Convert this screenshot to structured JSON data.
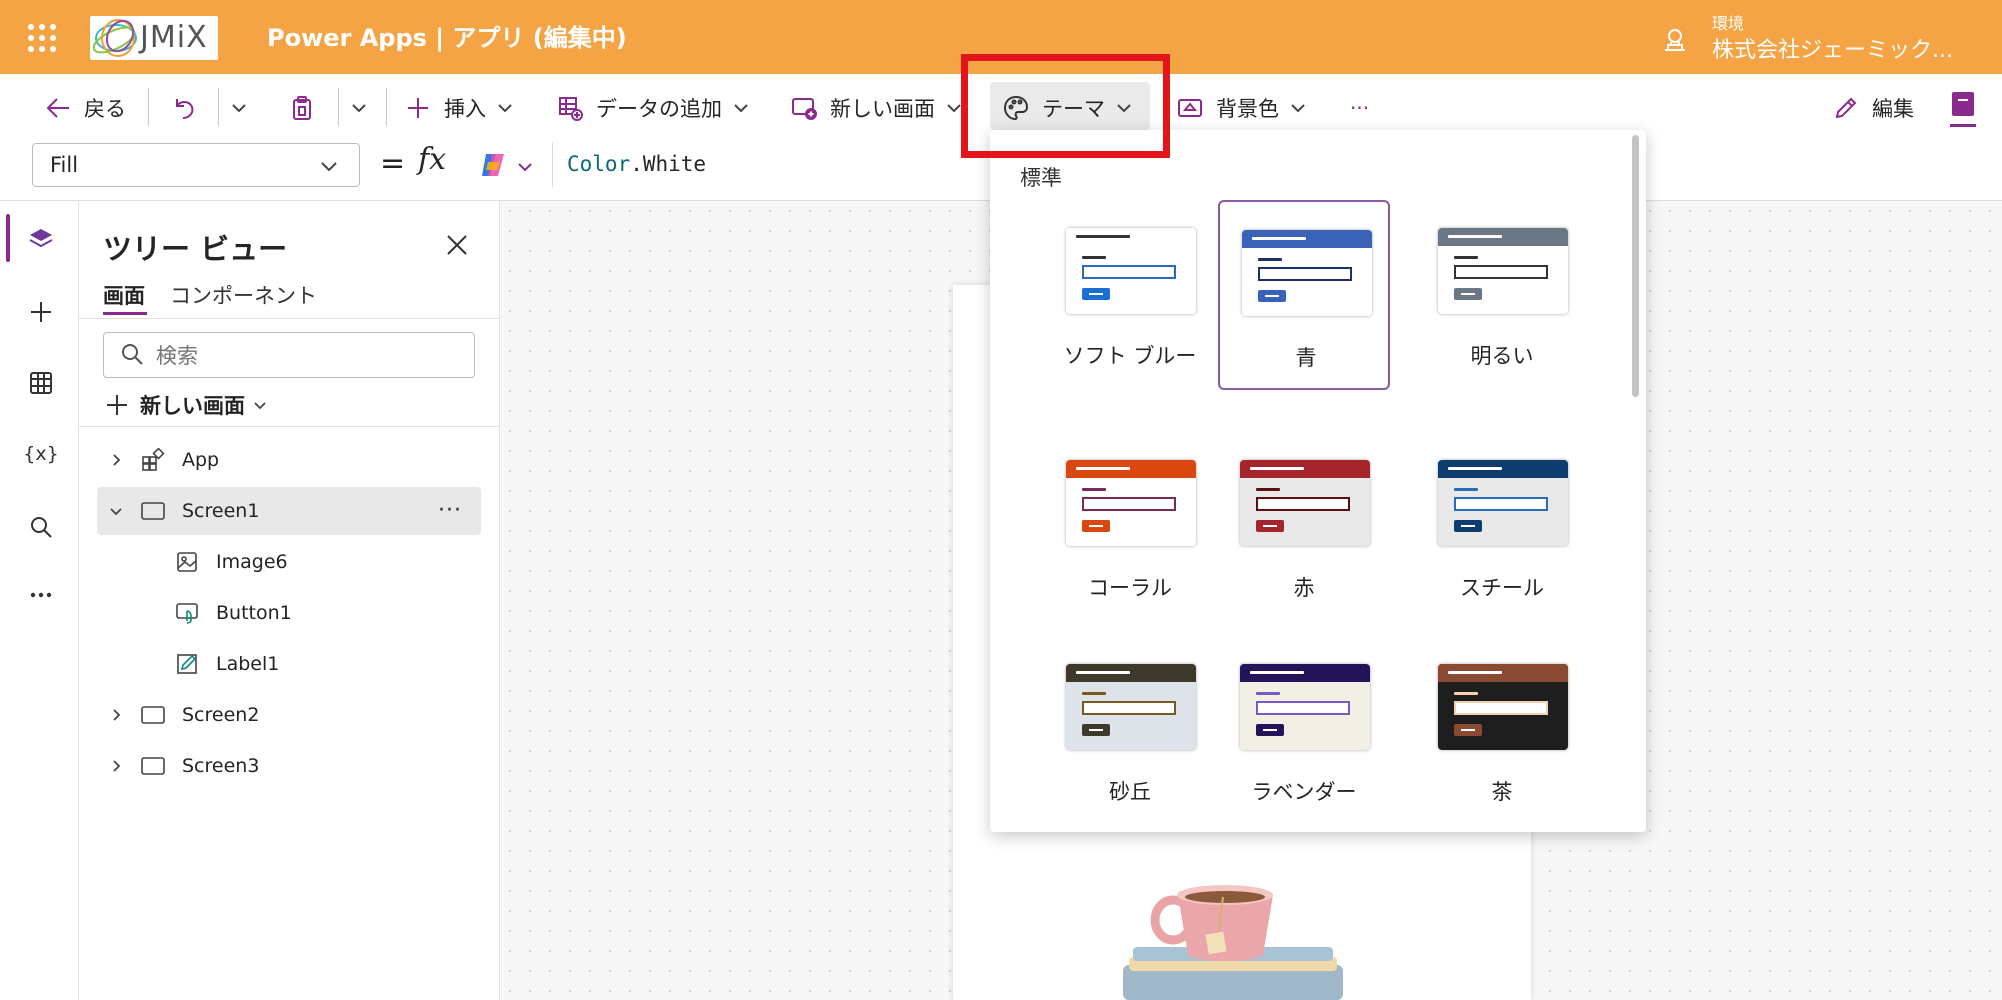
{
  "topbar": {
    "logo_text": "JMiX",
    "app_title": "Power Apps  |  アプリ (編集中)",
    "env_label": "環境",
    "env_name": "株式会社ジェーミック..."
  },
  "commands": {
    "back": "戻る",
    "insert": "挿入",
    "add_data": "データの追加",
    "new_screen": "新しい画面",
    "theme": "テーマ",
    "background": "背景色",
    "more": "···",
    "edit": "編集"
  },
  "formula_bar": {
    "property": "Fill",
    "eq": "=",
    "fx": "fx",
    "formula_obj": "Color",
    "formula_prop": ".White"
  },
  "tree": {
    "title": "ツリー ビュー",
    "tabs": [
      "画面",
      "コンポーネント"
    ],
    "search_placeholder": "検索",
    "new_screen": "新しい画面",
    "nodes": [
      "App",
      "Screen1",
      "Image6",
      "Button1",
      "Label1",
      "Screen2",
      "Screen3"
    ],
    "more": "···"
  },
  "theme_panel": {
    "section": "標準",
    "themes": [
      {
        "name": "ソフト ブルー",
        "band": "#ffffff",
        "line": "#333333",
        "input": "#2a6bb8",
        "button": "#1b6fd1",
        "bg": "#ffffff"
      },
      {
        "name": "青",
        "band": "#3a63b8",
        "line": "#1e2e6b",
        "input": "#1e2e6b",
        "button": "#3a63b8",
        "bg": "#ffffff",
        "selected": true
      },
      {
        "name": "明るい",
        "band": "#6b7785",
        "line": "#333333",
        "input": "#333333",
        "button": "#6b7785",
        "bg": "#ffffff"
      },
      {
        "name": "コーラル",
        "band": "#d9480f",
        "line": "#7a2a5a",
        "input": "#7a2a5a",
        "button": "#d9480f",
        "bg": "#ffffff"
      },
      {
        "name": "赤",
        "band": "#a4262c",
        "line": "#5a1010",
        "input": "#5a1010",
        "button": "#a4262c",
        "bg": "#e9e9e9"
      },
      {
        "name": "スチール",
        "band": "#0f3c6e",
        "line": "#2a6bb8",
        "input": "#2a6bb8",
        "button": "#0f3c6e",
        "bg": "#e9e9e9"
      },
      {
        "name": "砂丘",
        "band": "#3d3a2b",
        "line": "#7a5a1a",
        "input": "#7a5a1a",
        "button": "#3d3a2b",
        "bg": "#dde3e8"
      },
      {
        "name": "ラベンダー",
        "band": "#23145a",
        "line": "#7a58c8",
        "input": "#7a58c8",
        "button": "#23145a",
        "bg": "#f2efe4"
      },
      {
        "name": "茶",
        "band": "#8b4a33",
        "line": "#f2d0b0",
        "input": "#f2d0b0",
        "button": "#8b4a33",
        "bg": "#1e1e1e"
      }
    ]
  },
  "colors": {
    "topbar": "#f4a444",
    "accent": "#8a2a8f",
    "highlight": "#e3151b"
  }
}
